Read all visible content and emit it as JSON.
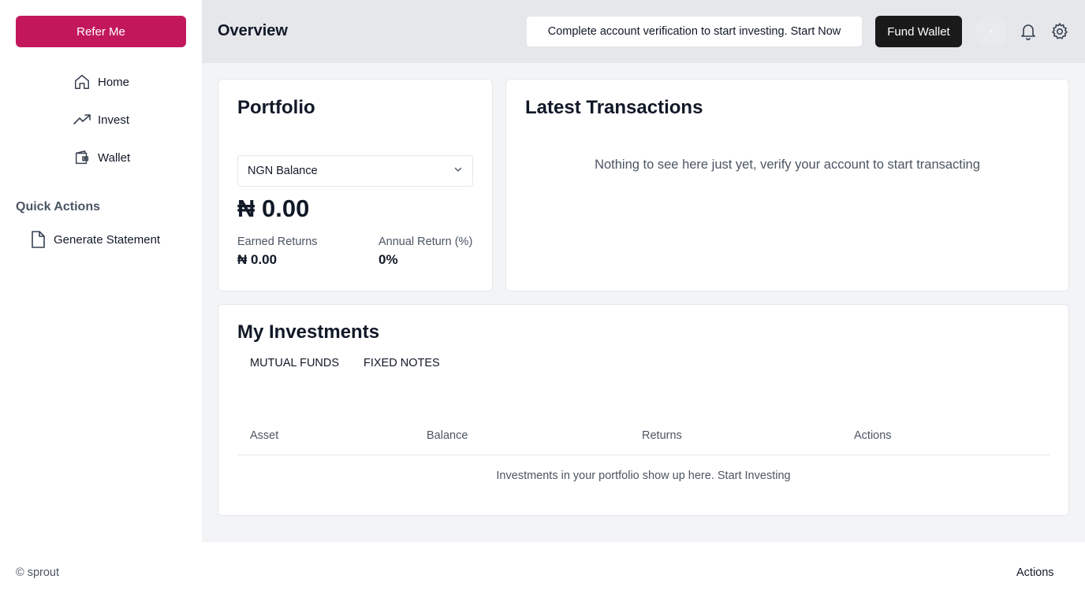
{
  "sidebar": {
    "refer_label": "Refer Me",
    "nav": [
      {
        "label": "Home",
        "icon": "home-icon"
      },
      {
        "label": "Invest",
        "icon": "trending-up-icon"
      },
      {
        "label": "Wallet",
        "icon": "wallet-icon"
      }
    ],
    "quick_actions_title": "Quick Actions",
    "quick_actions": [
      {
        "label": "Generate Statement",
        "icon": "document-icon"
      }
    ]
  },
  "header": {
    "title": "Overview",
    "verify_banner": "Complete account verification to start investing. Start Now",
    "fund_wallet_label": "Fund Wallet",
    "icons": [
      "avatar",
      "bell-icon",
      "gear-icon"
    ]
  },
  "portfolio": {
    "title": "Portfolio",
    "selected_balance": "NGN Balance",
    "balance": "₦ 0.00",
    "earned_returns_label": "Earned Returns",
    "earned_returns_value": "₦ 0.00",
    "annual_return_label": "Annual Return (%)",
    "annual_return_value": "0%"
  },
  "transactions": {
    "title": "Latest Transactions",
    "empty_text": "Nothing to see here just yet, verify your account to start transacting"
  },
  "investments": {
    "title": "My Investments",
    "tabs": [
      "MUTUAL FUNDS",
      "FIXED NOTES"
    ],
    "columns": [
      "Asset",
      "Balance",
      "Returns",
      "Actions"
    ],
    "empty_text": "Investments in your portfolio show up here. Start Investing"
  },
  "footer": {
    "copyright": "© sprout",
    "actions_label": "Actions"
  },
  "colors": {
    "accent": "#c2185b",
    "dark_button": "#1a1a1a",
    "background": "#f3f4f6",
    "header_bg": "#e5e7eb"
  }
}
